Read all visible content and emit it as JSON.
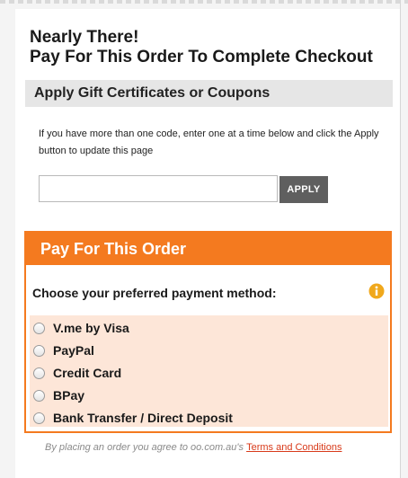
{
  "heading": {
    "line1": "Nearly There!",
    "line2": "Pay For This Order To Complete Checkout"
  },
  "gift": {
    "title": "Apply Gift Certificates or Coupons",
    "help_text": "If you have more than one code, enter one at a time below and click the Apply button to update this page",
    "code_value": "",
    "apply_label": "APPLY"
  },
  "payment": {
    "title": "Pay For This Order",
    "choose_label": "Choose your preferred payment method:",
    "info_icon": "info-icon",
    "methods": [
      {
        "label": "V.me by Visa",
        "selected": false
      },
      {
        "label": "PayPal",
        "selected": false
      },
      {
        "label": "Credit Card",
        "selected": false
      },
      {
        "label": "BPay",
        "selected": false
      },
      {
        "label": "Bank Transfer / Direct Deposit",
        "selected": false
      }
    ]
  },
  "terms": {
    "prefix": "By placing an order you agree to oo.com.au's ",
    "link_label": "Terms and Conditions"
  },
  "colors": {
    "accent": "#f47a1f",
    "method_bg": "#fde6d8",
    "apply_bg": "#5f5f5f",
    "link": "#d83a1a"
  }
}
